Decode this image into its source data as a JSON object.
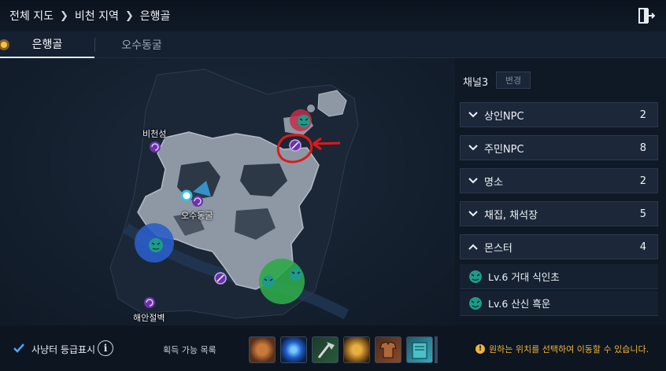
{
  "breadcrumb": [
    "전체 지도",
    "비천 지역",
    "은행골"
  ],
  "tabs": [
    {
      "label": "은행골",
      "active": true
    },
    {
      "label": "오수동굴",
      "active": false
    }
  ],
  "map": {
    "labels": {
      "bicheonseong": "비천성",
      "osudonggul": "오수동굴",
      "haeanjeolbyeok": "해안절벽"
    }
  },
  "panel": {
    "channel_label": "채널3",
    "channel_button": "변경",
    "categories": [
      {
        "label": "상인NPC",
        "count": "2",
        "expanded": false
      },
      {
        "label": "주민NPC",
        "count": "8",
        "expanded": false
      },
      {
        "label": "명소",
        "count": "2",
        "expanded": false
      },
      {
        "label": "채집, 채석장",
        "count": "5",
        "expanded": false
      },
      {
        "label": "몬스터",
        "count": "4",
        "expanded": true
      }
    ],
    "monsters": [
      {
        "label": "Lv.6 거대 식인초"
      },
      {
        "label": "Lv.6 산신 흑운"
      }
    ]
  },
  "footer": {
    "checkbox_label": "사냥터 등급표시",
    "checkbox_checked": true,
    "info_glyph": "i",
    "loot_label": "획득 가능 목록",
    "notice_glyph": "!",
    "notice": "원하는 위치를 선택하여 이동할 수 있습니다."
  },
  "colors": {
    "accent_orange": "#f0b43c",
    "annotation_red": "#e01818",
    "monster_green": "#2fa84a",
    "monster_blue": "#2a5ec8",
    "monster_red": "#c0304a",
    "portal_purple": "#8a46d0"
  }
}
